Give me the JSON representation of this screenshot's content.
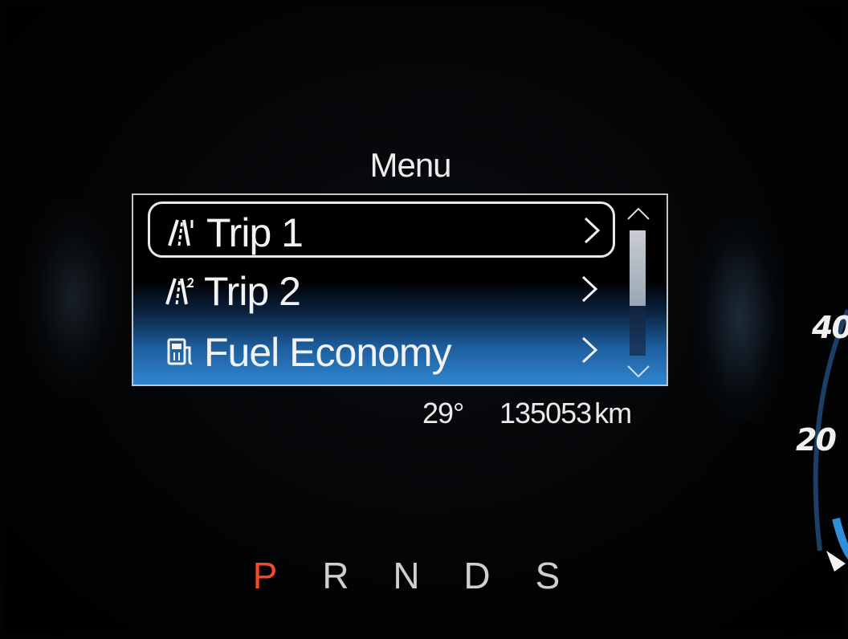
{
  "menu": {
    "title": "Menu",
    "items": [
      {
        "label": "Trip 1",
        "icon": "trip-1-road-icon",
        "selected": true
      },
      {
        "label": "Trip 2",
        "icon": "trip-2-road-icon",
        "selected": false
      },
      {
        "label": "Fuel Economy",
        "icon": "fuel-pump-icon",
        "selected": false
      }
    ],
    "scroll_position": 0.0,
    "scroll_visible_fraction": 0.6
  },
  "status": {
    "temperature": "29°",
    "odometer": "135053",
    "odometer_unit": "km"
  },
  "gears": {
    "options": [
      "P",
      "R",
      "N",
      "D",
      "S"
    ],
    "selected": "P"
  },
  "speedometer": {
    "labels": [
      "40",
      "20"
    ]
  },
  "colors": {
    "active_gear": "#f04a2a",
    "highlight_blue": "#2f86cf",
    "text": "#f2f2f2"
  }
}
